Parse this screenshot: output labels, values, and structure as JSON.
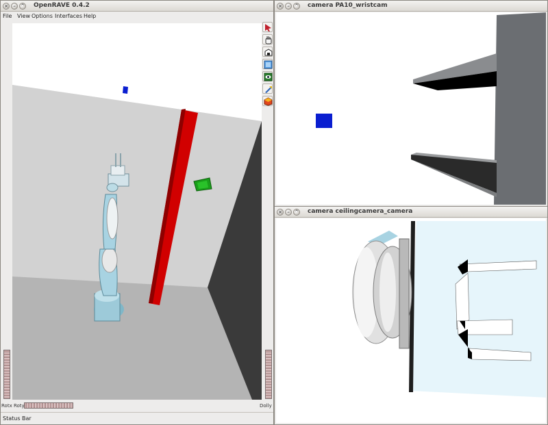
{
  "main_window": {
    "title": "OpenRAVE 0.4.2",
    "menu": [
      "File",
      "View",
      "Options",
      "Interfaces",
      "Help"
    ]
  },
  "toolbar": {
    "tools": [
      {
        "name": "pick-arrow-icon"
      },
      {
        "name": "hand-icon"
      },
      {
        "name": "home-view-icon"
      },
      {
        "name": "view-all-icon"
      },
      {
        "name": "seek-eye-icon"
      },
      {
        "name": "perspective-icon"
      },
      {
        "name": "collision-icon"
      }
    ]
  },
  "thumbwheels": {
    "left_label": "Rotx Roty",
    "right_label": "Dolly"
  },
  "status_bar": {
    "text": "Status Bar"
  },
  "camera_windows": [
    {
      "title": "camera PA10_wristcam"
    },
    {
      "title": "camera ceilingcamera_camera"
    }
  ],
  "colors": {
    "obstacle_red": "#d10000",
    "target_green": "#1a9e1a",
    "target_blue": "#0a1ed0",
    "robot_light_blue": "#a8d3e2",
    "wall_gray": "#d2d2d2",
    "floor_gray": "#b4b4b4",
    "dark_wall": "#3a3a3a"
  }
}
